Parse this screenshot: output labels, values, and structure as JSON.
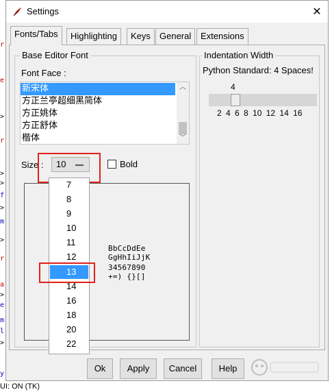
{
  "window": {
    "title": "Settings",
    "close_glyph": "✕"
  },
  "tabs": [
    {
      "label": "Fonts/Tabs",
      "active": true
    },
    {
      "label": "Highlighting",
      "active": false
    },
    {
      "label": "Keys",
      "active": false
    },
    {
      "label": "General",
      "active": false
    },
    {
      "label": "Extensions",
      "active": false
    }
  ],
  "base_font": {
    "group_title": "Base Editor Font",
    "font_face_label": "Font Face :",
    "fonts": [
      "新宋体",
      "方正兰亭超细黑简体",
      "方正姚体",
      "方正舒体",
      "楷体"
    ],
    "selected_font": "新宋体",
    "size_label": "Size :",
    "size_value": "10",
    "bold_label": "Bold",
    "bold_checked": false,
    "sample_lines": [
      "BbCcDdEe",
      "GgHhIiJjK",
      "34567890",
      "+=) {}[]"
    ]
  },
  "size_dropdown": {
    "options": [
      "7",
      "8",
      "9",
      "10",
      "11",
      "12",
      "13",
      "14",
      "16",
      "18",
      "20",
      "22"
    ],
    "selected": "13"
  },
  "indentation": {
    "group_title": "Indentation Width",
    "standard_label": "Python Standard: 4 Spaces!",
    "value": "4",
    "ticks": "2 4 6 8 10 12 14 16"
  },
  "buttons": {
    "ok": "Ok",
    "apply": "Apply",
    "cancel": "Cancel",
    "help": "Help"
  },
  "background": {
    "status_text": "UI: ON (TK)"
  },
  "colors": {
    "highlight": "#3399ff",
    "annotation_red": "#e0201c"
  }
}
